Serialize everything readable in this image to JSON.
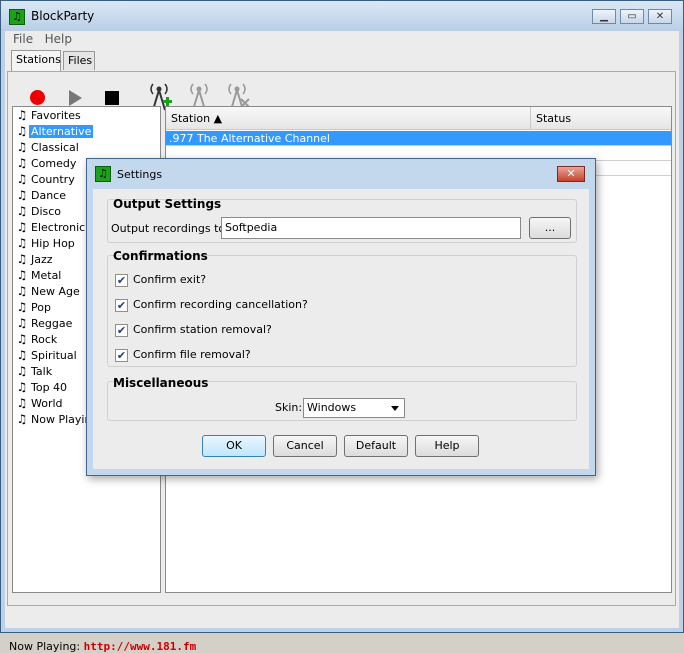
{
  "window": {
    "title": "BlockParty"
  },
  "menu": [
    "File",
    "Help"
  ],
  "tabs": [
    "Stations",
    "Files"
  ],
  "categories": [
    "Favorites",
    "Alternative",
    "Classical",
    "Comedy",
    "Country",
    "Dance",
    "Disco",
    "Electronic",
    "Hip Hop",
    "Jazz",
    "Metal",
    "New Age",
    "Pop",
    "Reggae",
    "Rock",
    "Spiritual",
    "Talk",
    "Top 40",
    "World",
    "Now Playing"
  ],
  "selected_category": "Alternative",
  "stations_table": {
    "columns": [
      "Station",
      "Status"
    ],
    "rows": [
      {
        "station": ".977 The Alternative Channel",
        "status": ""
      }
    ]
  },
  "status_bar": {
    "label": "Now Playing:",
    "value": "http://www.181.fm"
  },
  "dialog": {
    "title": "Settings",
    "output": {
      "heading": "Output Settings",
      "label": "Output recordings to:",
      "value": "Softpedia",
      "browse_label": "..."
    },
    "confirmations": {
      "heading": "Confirmations",
      "items": [
        {
          "label": "Confirm exit?",
          "checked": true
        },
        {
          "label": "Confirm recording cancellation?",
          "checked": true
        },
        {
          "label": "Confirm station removal?",
          "checked": true
        },
        {
          "label": "Confirm file removal?",
          "checked": true
        }
      ]
    },
    "misc": {
      "heading": "Miscellaneous",
      "skin_label": "Skin:",
      "skin_value": "Windows"
    },
    "buttons": {
      "ok": "OK",
      "cancel": "Cancel",
      "default": "Default",
      "help": "Help"
    }
  },
  "colors": {
    "selection": "#3399ff",
    "record": "#ee0000",
    "now_playing_url": "#cc0000"
  }
}
